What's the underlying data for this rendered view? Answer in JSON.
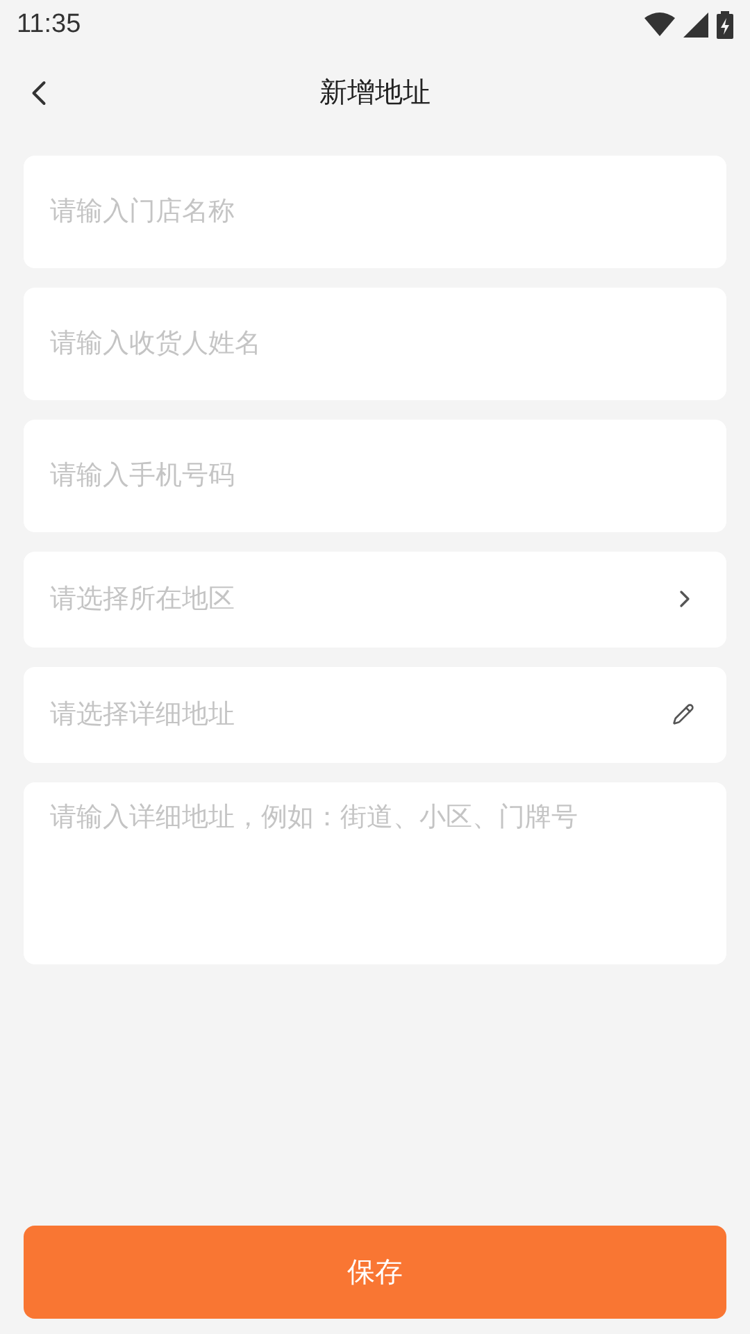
{
  "status_bar": {
    "time": "11:35"
  },
  "header": {
    "title": "新增地址"
  },
  "fields": [
    {
      "kind": "input",
      "placeholder": "请输入门店名称"
    },
    {
      "kind": "input",
      "placeholder": "请输入收货人姓名"
    },
    {
      "kind": "input",
      "placeholder": "请输入手机号码"
    },
    {
      "kind": "select",
      "placeholder": "请选择所在地区"
    },
    {
      "kind": "edit",
      "placeholder": "请选择详细地址"
    },
    {
      "kind": "textarea",
      "placeholder": "请输入详细地址，例如：街道、小区、门牌号"
    }
  ],
  "save_button": {
    "label": "保存"
  }
}
